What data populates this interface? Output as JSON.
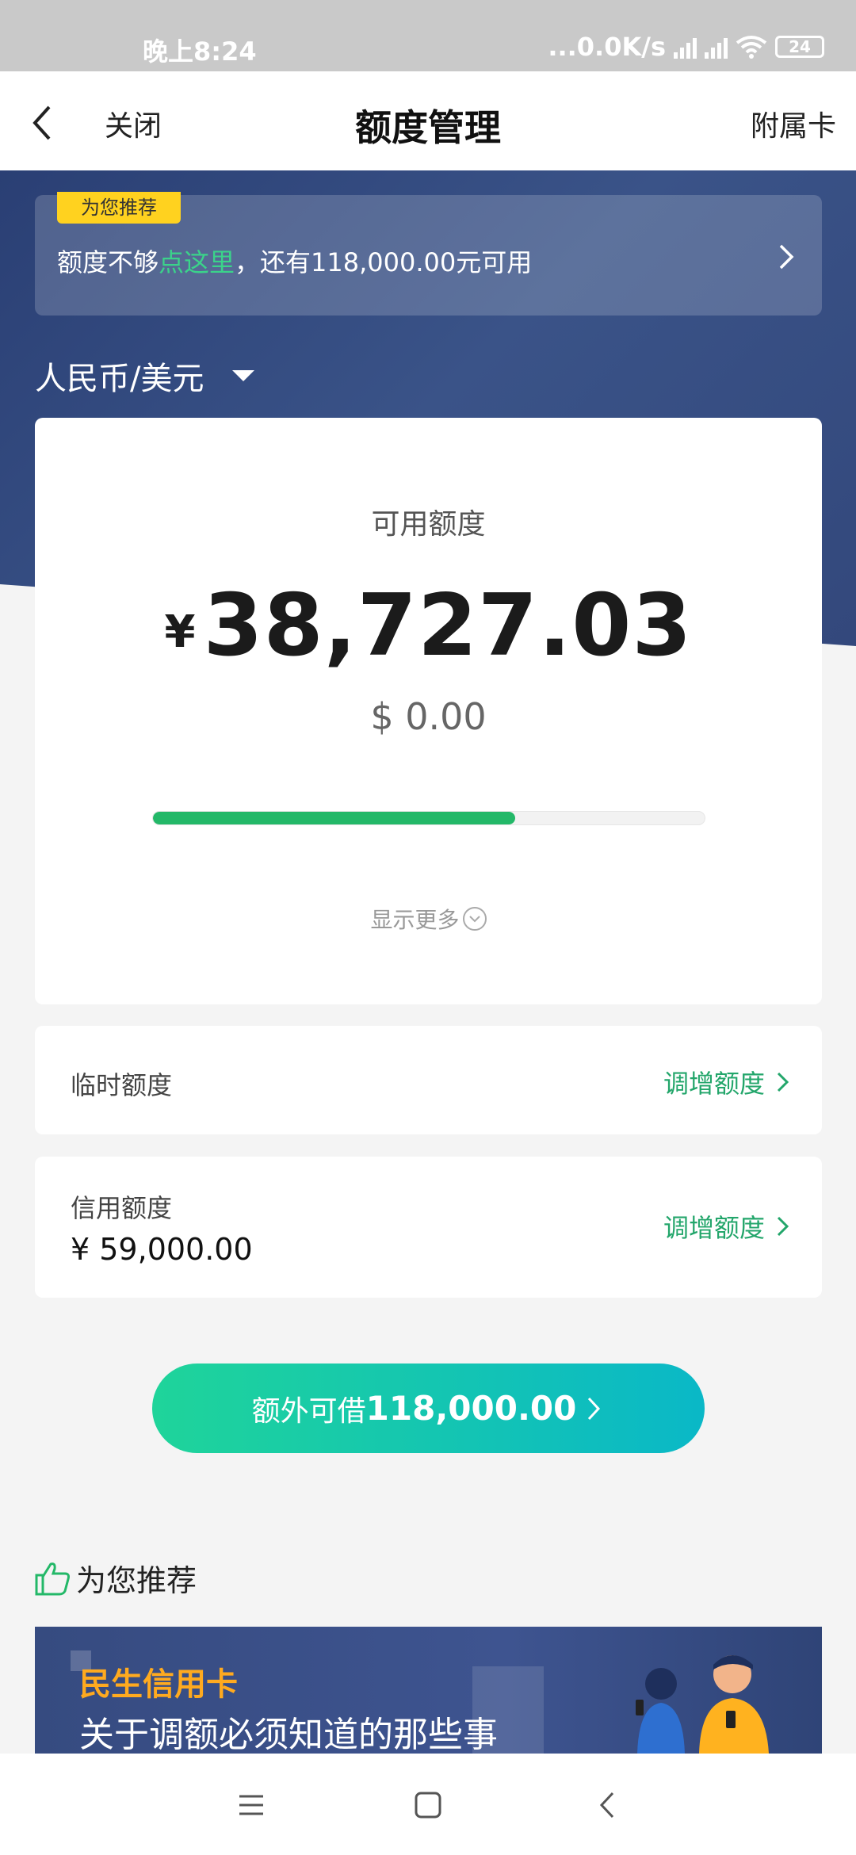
{
  "status_bar": {
    "time": "晚上8:24",
    "network": "...0.0K/s",
    "battery": "24"
  },
  "nav": {
    "close_label": "关闭",
    "title": "额度管理",
    "right_label": "附属卡"
  },
  "promo": {
    "tag": "为您推荐",
    "text_prefix": "额度不够",
    "text_highlight": "点这里",
    "text_suffix": "，还有118,000.00元可用"
  },
  "currency_selector": "人民币/美元",
  "available": {
    "label": "可用额度",
    "cny_symbol": "¥",
    "cny_amount": "38,727.03",
    "usd_amount": "$ 0.00",
    "progress_fraction": 0.656,
    "show_more": "显示更多"
  },
  "temporary_limit": {
    "label": "临时额度",
    "action": "调增额度"
  },
  "credit_limit": {
    "label": "信用额度",
    "value": "¥ 59,000.00",
    "action": "调增额度"
  },
  "cta": {
    "prefix": "额外可借",
    "amount": "118,000.00"
  },
  "recommend": {
    "title": "为您推荐",
    "banner_sub": "民生信用卡",
    "banner_main": "关于调额必须知道的那些事"
  },
  "colors": {
    "accent_green": "#23b868",
    "header_blue": "#33487c",
    "highlight_green": "#3bd38a",
    "tag_yellow": "#ffd21f"
  }
}
